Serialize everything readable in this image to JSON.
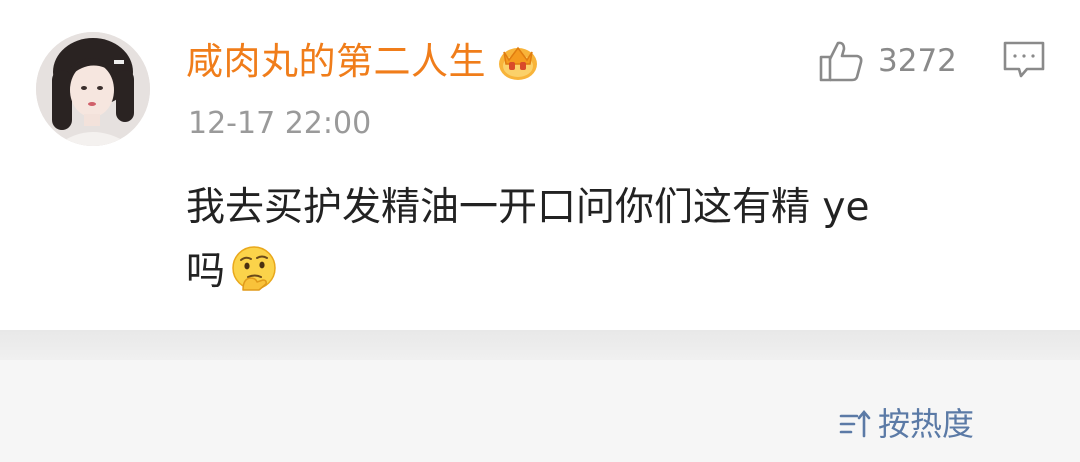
{
  "comment": {
    "username": "咸肉丸的第二人生",
    "badge_icon": "crown-badge-icon",
    "timestamp": "12-17 22:00",
    "like_count": "3272",
    "text_line1": "我去买护发精油一开口问你们这有精 ye",
    "text_line2": "吗",
    "emoji": "thinking-face-emoji"
  },
  "sort_bar": {
    "label": "按热度",
    "icon": "sort-arrows-icon"
  },
  "colors": {
    "username": "#f07d1a",
    "timestamp": "#9a9a9a",
    "like": "#8a8a8a",
    "text": "#222222",
    "sort_label": "#5b7aa6",
    "divider": "#e8e8e8",
    "sort_bar_bg": "#f6f6f6"
  }
}
